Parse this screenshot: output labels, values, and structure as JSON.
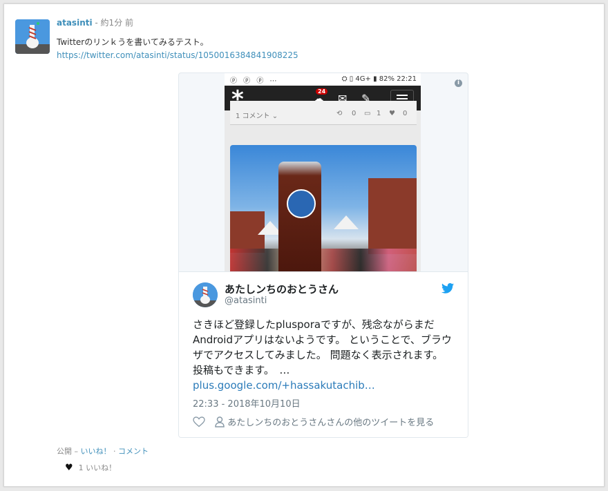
{
  "post": {
    "author": "atasinti",
    "time": " - 約1分 前",
    "text": "Twitterのリンｋうを書いてみるテスト。",
    "link": "https://twitter.com/atasinti/status/1050016384841908225"
  },
  "screenshot": {
    "status_left": "ⓟ ⓟ ⓟ ⋯",
    "status_right": "⛭ ▯ 4G+ ▮ 82% 22:21",
    "badge": "24",
    "post_comments": "1 コメント ⌄",
    "reshares": "0",
    "comments": "1",
    "likes": "0"
  },
  "tweet": {
    "name": "あたしンちのおとうさん",
    "handle": "@atasinti",
    "body": "さきほど登録したplusporaですが、残念ながらまだAndroidアプリはないようです。 ということで、ブラウザでアクセスしてみました。 問題なく表示されます。　　投稿もできます。　…",
    "body_link": "plus.google.com/+hassakutachib…",
    "date": "22:33 - 2018年10月10日",
    "more_label": "あたしンちのおとうさんさんの他のツイートを見る"
  },
  "footer": {
    "visibility": "公開 – ",
    "like_action": "いいね！",
    "separator": " · ",
    "comment_action": "コメント",
    "likes_count": "1 いいね！"
  },
  "colors": {
    "link": "#3f8fba",
    "twitter_blue": "#1da1f2"
  }
}
